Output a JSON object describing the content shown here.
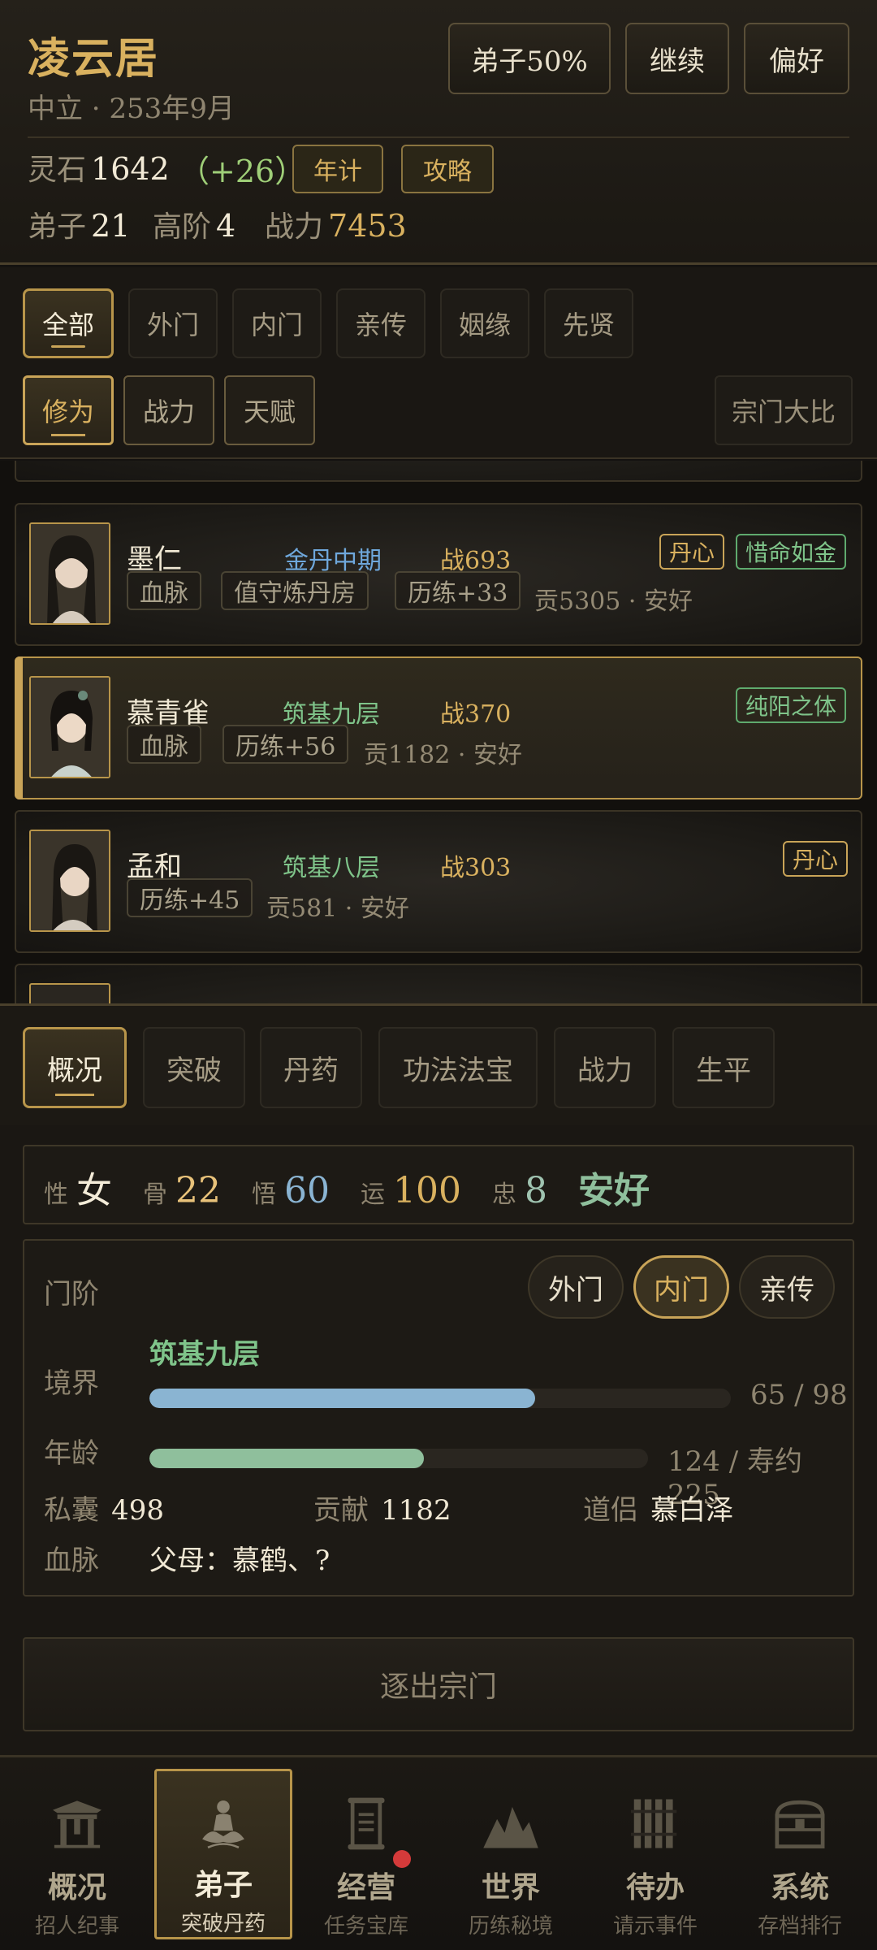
{
  "header": {
    "sect_name": "凌云居",
    "subtitle": "中立 · 253年9月",
    "buttons": {
      "disciple_ratio": "弟子50%",
      "continue": "继续",
      "preferences": "偏好"
    },
    "stone_label": "灵石",
    "stone_value": "1642",
    "stone_gain": "（+26）",
    "yearly_button": "年计",
    "guide_button": "攻略",
    "disciples_label": "弟子",
    "disciples_value": "21",
    "senior_label": "高阶",
    "senior_value": "4",
    "power_label": "战力",
    "power_value": "7453"
  },
  "filters": {
    "tabs": [
      "全部",
      "外门",
      "内门",
      "亲传",
      "姻缘",
      "先贤"
    ],
    "sort_tabs": [
      "修为",
      "战力",
      "天赋"
    ],
    "compare_button": "宗门大比"
  },
  "disciples": [
    {
      "name": "墨仁",
      "realm": "金丹中期",
      "realm_color": "#6fa8dc",
      "power": "战693",
      "tags": [
        "血脉",
        "值守炼丹房",
        "历练+33"
      ],
      "info": "贡5305 · 安好",
      "badges": [
        {
          "text": "丹心",
          "type": "gold"
        },
        {
          "text": "惜命如金",
          "type": "green"
        }
      ]
    },
    {
      "name": "慕青雀",
      "realm": "筑基九层",
      "realm_color": "#7fc48a",
      "power": "战370",
      "tags": [
        "血脉",
        "历练+56"
      ],
      "info": "贡1182 · 安好",
      "badges": [
        {
          "text": "纯阳之体",
          "type": "green"
        }
      ]
    },
    {
      "name": "孟和",
      "realm": "筑基八层",
      "realm_color": "#7fc48a",
      "power": "战303",
      "tags": [
        "历练+45"
      ],
      "info": "贡581 · 安好",
      "badges": [
        {
          "text": "丹心",
          "type": "gold"
        }
      ]
    }
  ],
  "detail_tabs": [
    "概况",
    "突破",
    "丹药",
    "功法法宝",
    "战力",
    "生平"
  ],
  "detail": {
    "gender_label": "性",
    "gender": "女",
    "bone_label": "骨",
    "bone": "22",
    "wisdom_label": "悟",
    "wisdom": "60",
    "luck_label": "运",
    "luck": "100",
    "loyalty_label": "忠",
    "loyalty": "8",
    "status": "安好",
    "rank_label": "门阶",
    "rank_options": [
      "外门",
      "内门",
      "亲传"
    ],
    "rank_selected": "内门",
    "realm_label": "境界",
    "realm_value": "筑基九层",
    "realm_progress": 0.663,
    "realm_progress_text": "65 / 98",
    "age_label": "年龄",
    "age_progress": 0.551,
    "age_text": "124 / 寿约225",
    "purse_label": "私囊",
    "purse_value": "498",
    "contribution_label": "贡献",
    "contribution_value": "1182",
    "partner_label": "道侣",
    "partner_value": "慕白泽",
    "lineage_label": "血脉",
    "lineage_value": "父母：慕鹤、?",
    "expel_button": "逐出宗门"
  },
  "bottom_nav": [
    {
      "label": "概况",
      "sub": "招人纪事",
      "icon": "gate-icon"
    },
    {
      "label": "弟子",
      "sub": "突破丹药",
      "icon": "meditation-icon"
    },
    {
      "label": "经营",
      "sub": "任务宝库",
      "icon": "scroll-icon"
    },
    {
      "label": "世界",
      "sub": "历练秘境",
      "icon": "mountain-icon"
    },
    {
      "label": "待办",
      "sub": "请示事件",
      "icon": "bamboo-slips-icon"
    },
    {
      "label": "系统",
      "sub": "存档排行",
      "icon": "chest-icon"
    }
  ],
  "colors": {
    "gold": "#d9b15f",
    "green": "#7fc48a",
    "blue": "#6fa8dc",
    "realm_bar": "#8ab4d2",
    "age_bar": "#8fbf9c"
  }
}
